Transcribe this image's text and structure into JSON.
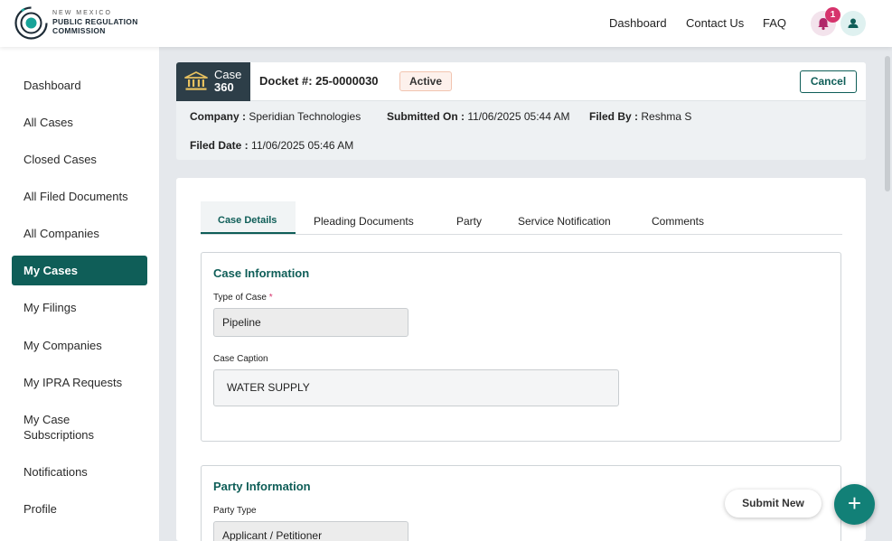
{
  "brand": {
    "line1": "NEW MEXICO",
    "line2": "PUBLIC REGULATION",
    "line3": "COMMISSION",
    "color": "#0f5e58"
  },
  "topnav": {
    "dashboard": "Dashboard",
    "contact": "Contact Us",
    "faq": "FAQ",
    "notification_count": "1"
  },
  "sidebar": {
    "items": [
      {
        "label": "Dashboard"
      },
      {
        "label": "All Cases"
      },
      {
        "label": "Closed Cases"
      },
      {
        "label": "All Filed Documents"
      },
      {
        "label": "All Companies"
      },
      {
        "label": "My Cases",
        "active": true
      },
      {
        "label": "My Filings"
      },
      {
        "label": "My Companies"
      },
      {
        "label": "My IPRA Requests"
      },
      {
        "label": "My Case Subscriptions"
      },
      {
        "label": "Notifications"
      },
      {
        "label": "Profile"
      }
    ]
  },
  "case": {
    "logo_line1": "Case",
    "logo_line2": "360",
    "docket": "Docket #: 25-0000030",
    "status": "Active",
    "cancel_label": "Cancel",
    "company_label": "Company :",
    "company": "Speridian Technologies",
    "submitted_label": "Submitted On :",
    "submitted": "11/06/2025 05:44 AM",
    "filed_by_label": "Filed By :",
    "filed_by": "Reshma S",
    "filed_date_label": "Filed Date :",
    "filed_date": "11/06/2025 05:46 AM"
  },
  "tabs": [
    "Case Details",
    "Pleading Documents",
    "Party",
    "Service Notification",
    "Comments"
  ],
  "case_info": {
    "title": "Case Information",
    "type_label": "Type of Case",
    "required_mark": "*",
    "type_value": "Pipeline",
    "caption_label": "Case Caption",
    "caption_value": "WATER SUPPLY"
  },
  "party_info": {
    "title": "Party Information",
    "type_label": "Party Type",
    "type_value": "Applicant / Petitioner"
  },
  "actions": {
    "submit_new": "Submit New",
    "fab": "+"
  }
}
